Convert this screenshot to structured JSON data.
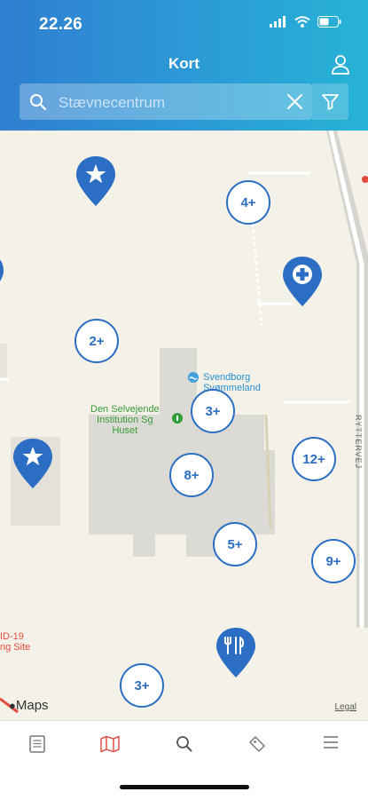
{
  "status_bar": {
    "time": "22.26"
  },
  "header": {
    "title": "Kort"
  },
  "search": {
    "placeholder": "Stævnecentrum",
    "value": ""
  },
  "map": {
    "clusters": [
      {
        "label": "4+"
      },
      {
        "label": "2+"
      },
      {
        "label": "3+"
      },
      {
        "label": "8+"
      },
      {
        "label": "12+"
      },
      {
        "label": "5+"
      },
      {
        "label": "9+"
      },
      {
        "label": "3+"
      }
    ],
    "places": {
      "svendborg": "Svendborg\nSvømmeland",
      "institution": "Den Selvejende\nInstitution Sg\nHuset",
      "covid": "ID-19\nng Site",
      "road": "RYTTERVEJ"
    },
    "attribution": {
      "maps": "Maps",
      "legal": "Legal"
    }
  },
  "tabs": [
    {
      "icon": "news-icon",
      "active": false
    },
    {
      "icon": "map-icon",
      "active": true
    },
    {
      "icon": "search-icon",
      "active": false
    },
    {
      "icon": "ticket-icon",
      "active": false
    },
    {
      "icon": "menu-icon",
      "active": false
    }
  ],
  "colors": {
    "accent": "#2b6ec4",
    "active_tab": "#e0534a",
    "header_start": "#2f7fd0",
    "header_end": "#27b3d6"
  }
}
